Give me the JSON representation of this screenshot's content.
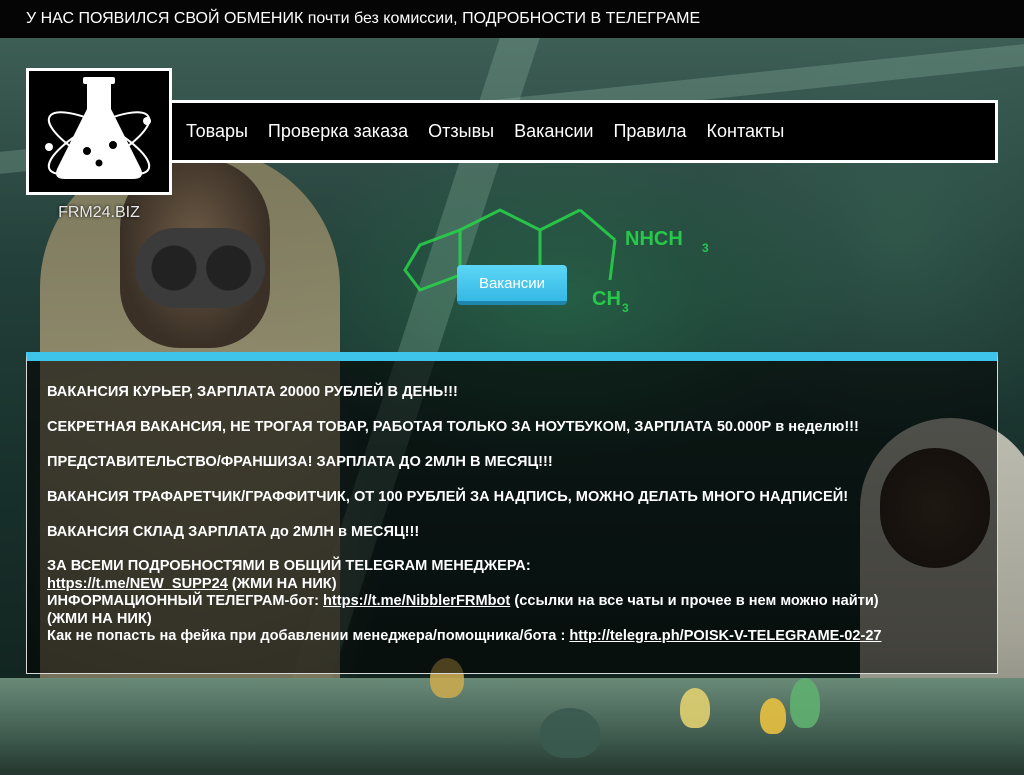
{
  "announcement": "У НАС ПОЯВИЛСЯ СВОЙ ОБМЕНИК почти без комиссии, ПОДРОБНОСТИ В ТЕЛЕГРАМЕ",
  "brand": {
    "name": "FRM24.BIZ"
  },
  "nav": {
    "items": [
      {
        "label": "Товары"
      },
      {
        "label": "Проверка заказа"
      },
      {
        "label": "Отзывы"
      },
      {
        "label": "Вакансии"
      },
      {
        "label": "Правила"
      },
      {
        "label": "Контакты"
      }
    ]
  },
  "page_button": "Вакансии",
  "vacancies": [
    "ВАКАНСИЯ КУРЬЕР, ЗАРПЛАТА 20000 РУБЛЕЙ В ДЕНЬ!!!",
    "СЕКРЕТНАЯ ВАКАНСИЯ, НЕ ТРОГАЯ ТОВАР, РАБОТАЯ ТОЛЬКО ЗА НОУТБУКОМ, ЗАРПЛАТА 50.000Р в неделю!!!",
    "ПРЕДСТАВИТЕЛЬСТВО/ФРАНШИЗА! ЗАРПЛАТА ДО 2МЛН В МЕСЯЦ!!!",
    "ВАКАНСИЯ ТРАФАРЕТЧИК/ГРАФФИТЧИК, ОТ 100 РУБЛЕЙ ЗА НАДПИСЬ, МОЖНО ДЕЛАТЬ МНОГО НАДПИСЕЙ!",
    "ВАКАНСИЯ СКЛАД ЗАРПЛАТА до 2МЛН в МЕСЯЦ!!!"
  ],
  "contacts": {
    "heading": "ЗА ВСЕМИ ПОДРОБНОСТЯМИ В ОБЩИЙ TELEGRAM МЕНЕДЖЕРА:",
    "manager_link": "https://t.me/NEW_SUPP24",
    "manager_note": " (ЖМИ НА НИК)",
    "bot_label": "ИНФОРМАЦИОННЫЙ ТЕЛЕГРАМ-бот: ",
    "bot_link": "https://t.me/NibblerFRMbot",
    "bot_note": " (ссылки на все чаты и прочее в нем можно найти)",
    "bot_note2": "(ЖМИ НА НИК)",
    "fake_label": "Как не попасть на фейка при добавлении менеджера/помощника/бота : ",
    "fake_link": "http://telegra.ph/POISK-V-TELEGRAME-02-27"
  },
  "colors": {
    "accent": "#3ec3ea",
    "button": "#36b9e6",
    "molecule": "#27d64a"
  }
}
